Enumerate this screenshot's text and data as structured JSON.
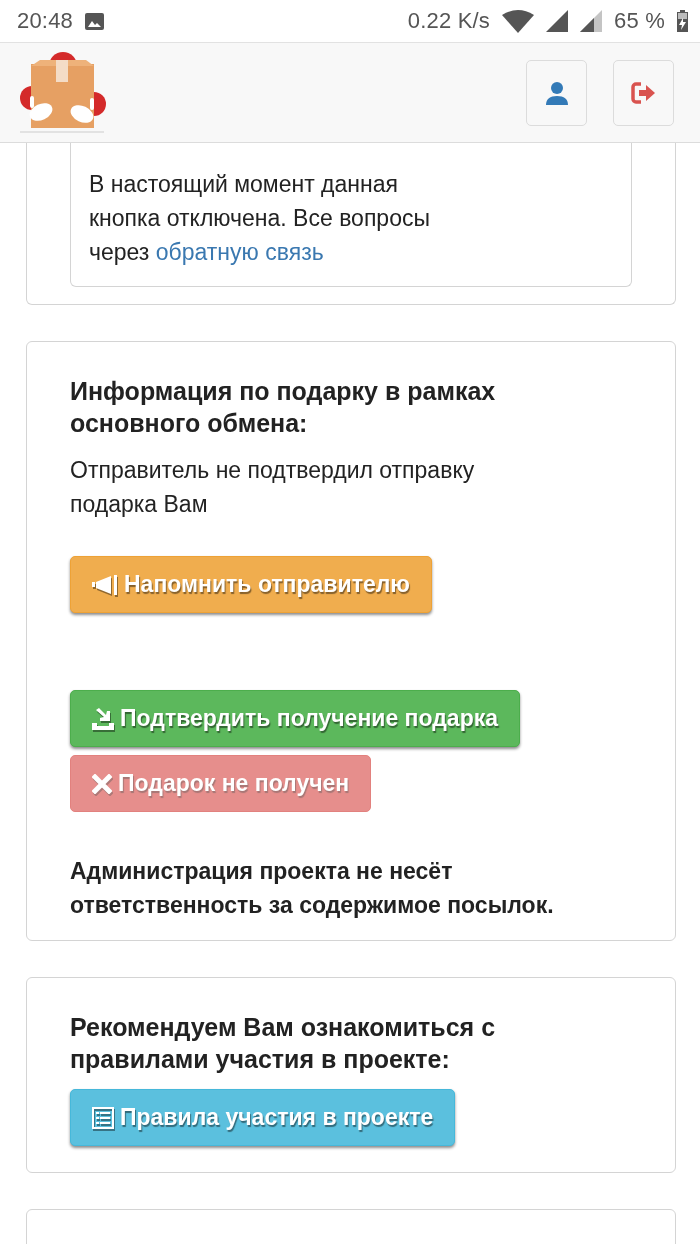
{
  "status_bar": {
    "time": "20:48",
    "network_speed": "0.22 K/s",
    "battery": "65 %"
  },
  "sections": [
    {
      "notice": {
        "text": "В настоящий момент данная кнопка отключена. Все вопросы через",
        "link": "обратную связь"
      }
    },
    {
      "title": "Информация по подарку в рамках основного обмена:",
      "text": "Отправитель не подтвердил отправку подарка Вам",
      "button_groups": [
        [
          {
            "kind": "warning",
            "label": "Напомнить отправителю",
            "disabled": false
          }
        ],
        [
          {
            "kind": "success",
            "label": "Подтвердить получение подарка",
            "disabled": false
          },
          {
            "kind": "danger",
            "label": "Подарок не получен",
            "disabled": true
          }
        ]
      ],
      "note": "Администрация проекта не несёт ответственность за содержимое посылок."
    },
    {
      "title": "Рекомендуем Вам ознакомиться с правилами участия в проекте:",
      "button_groups": [
        [
          {
            "kind": "info",
            "label": "Правила участия в проекте",
            "disabled": false
          }
        ]
      ]
    }
  ]
}
